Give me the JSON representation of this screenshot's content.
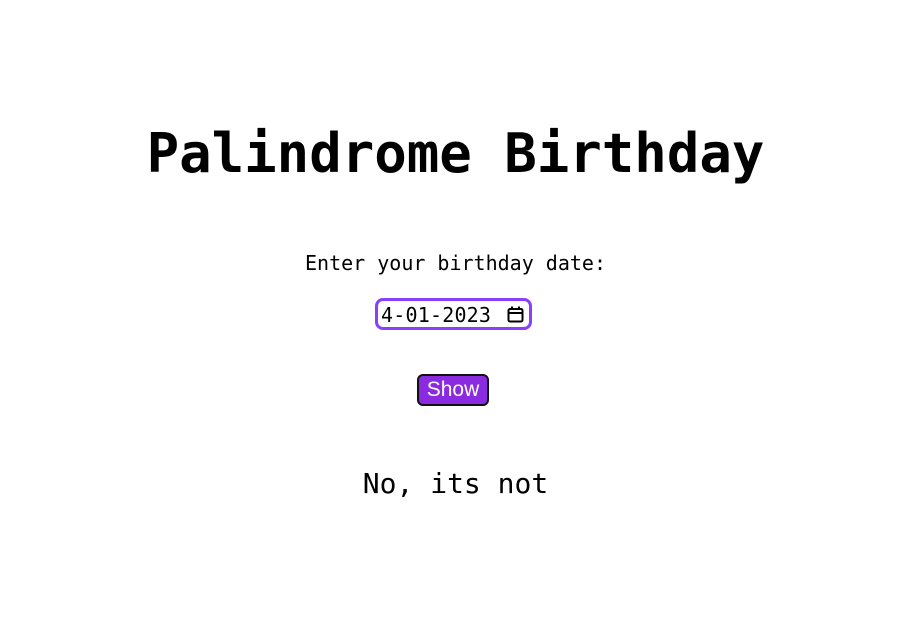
{
  "header": {
    "title": "Palindrome Birthday"
  },
  "form": {
    "label": "Enter your birthday date:",
    "date_value_visible": "4-01-2023",
    "date_icon": "calendar-icon",
    "submit_label": "Show"
  },
  "output": {
    "message": "No, its not"
  },
  "colors": {
    "accent": "#8a2be2",
    "input_border": "#8a3ffc",
    "text": "#000000",
    "background": "#ffffff"
  }
}
